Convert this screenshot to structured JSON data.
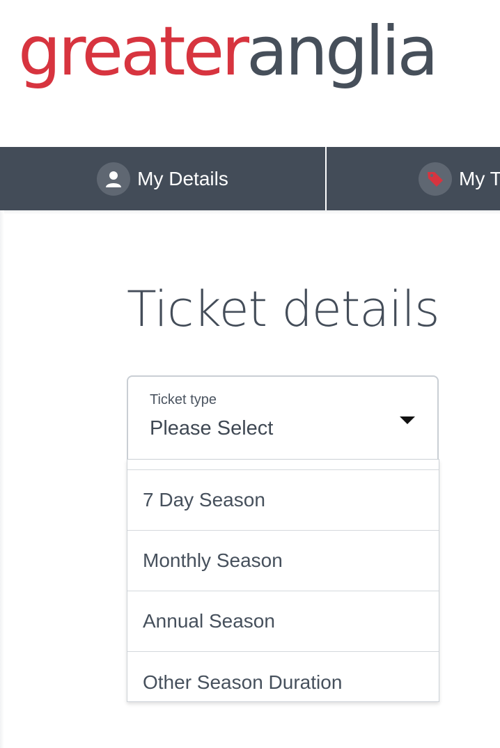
{
  "brand": {
    "logo_part1": "greater",
    "logo_part2": "anglia",
    "logo_color_primary": "#d7343f",
    "logo_color_secondary": "#464f5a"
  },
  "nav": {
    "background": "#434c58",
    "tabs": [
      {
        "label": "My Details",
        "icon": "user-icon"
      },
      {
        "label": "My T",
        "icon": "tag-icon"
      }
    ]
  },
  "main": {
    "heading": "Ticket details",
    "ticket_type": {
      "label": "Ticket type",
      "value": "Please Select",
      "options": [
        "7 Day Season",
        "Monthly Season",
        "Annual Season",
        "Other Season Duration"
      ]
    }
  }
}
